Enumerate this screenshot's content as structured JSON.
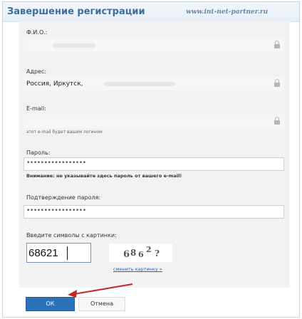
{
  "dialog": {
    "title": "Завершение регистрации",
    "watermark": "www.int-net-partner.ru"
  },
  "form": {
    "fio_label": "Ф.И.О.:",
    "fio_value": "",
    "address_label": "Адрес:",
    "address_value": "Россия, Иркутск,",
    "email_label": "E-mail:",
    "email_value": "",
    "email_hint": "этот e-mail будет вашим логином",
    "password_label": "Пароль:",
    "password_value": "•••••••••••••••••",
    "password_warning": "Внимание: не указывайте здесь пароль от вашего e-mail!",
    "confirm_label": "Подтверждение пароля:",
    "confirm_value": "•••••••••••••••••",
    "captcha_label": "Введите символы с картинки:",
    "captcha_value": "68621",
    "captcha_image_text": [
      "6",
      "8",
      "6",
      "2",
      "?"
    ],
    "change_image_link": "сменить картинку »"
  },
  "buttons": {
    "ok": "ОК",
    "cancel": "Отмена"
  },
  "colors": {
    "title": "#3a6f9e",
    "ok_button": "#2b72b8",
    "annotation_arrow": "#c0282d",
    "link": "#2d62b2"
  },
  "icons": {
    "field_lock": "lock-icon"
  }
}
